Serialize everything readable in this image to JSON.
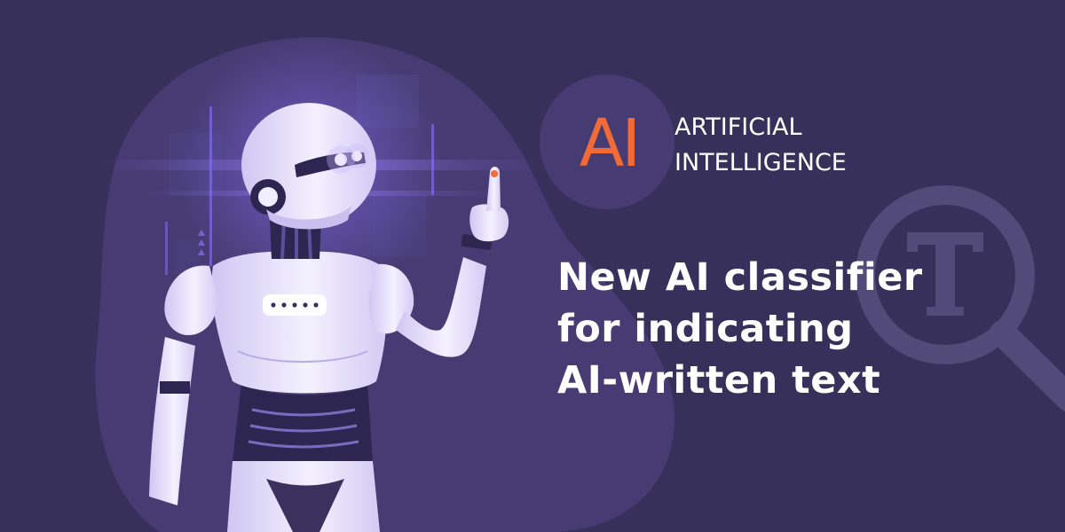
{
  "banner": {
    "logo": {
      "mark": "AI",
      "line1": "ARTIFICIAL",
      "line2": "INTELLIGENCE"
    },
    "headline": {
      "line1": "New AI classifier",
      "line2": "for indicating",
      "line3": "AI-written text"
    },
    "icons": [
      "robot-illustration",
      "magnifier-icon",
      "text-t-icon"
    ],
    "colors": {
      "background": "#37305a",
      "blob": "#463c73",
      "accent_orange": "#f26a35",
      "robot_white": "#f1eeff",
      "robot_shadow": "#b7aee4",
      "glow_purple": "#8a72ff"
    }
  }
}
